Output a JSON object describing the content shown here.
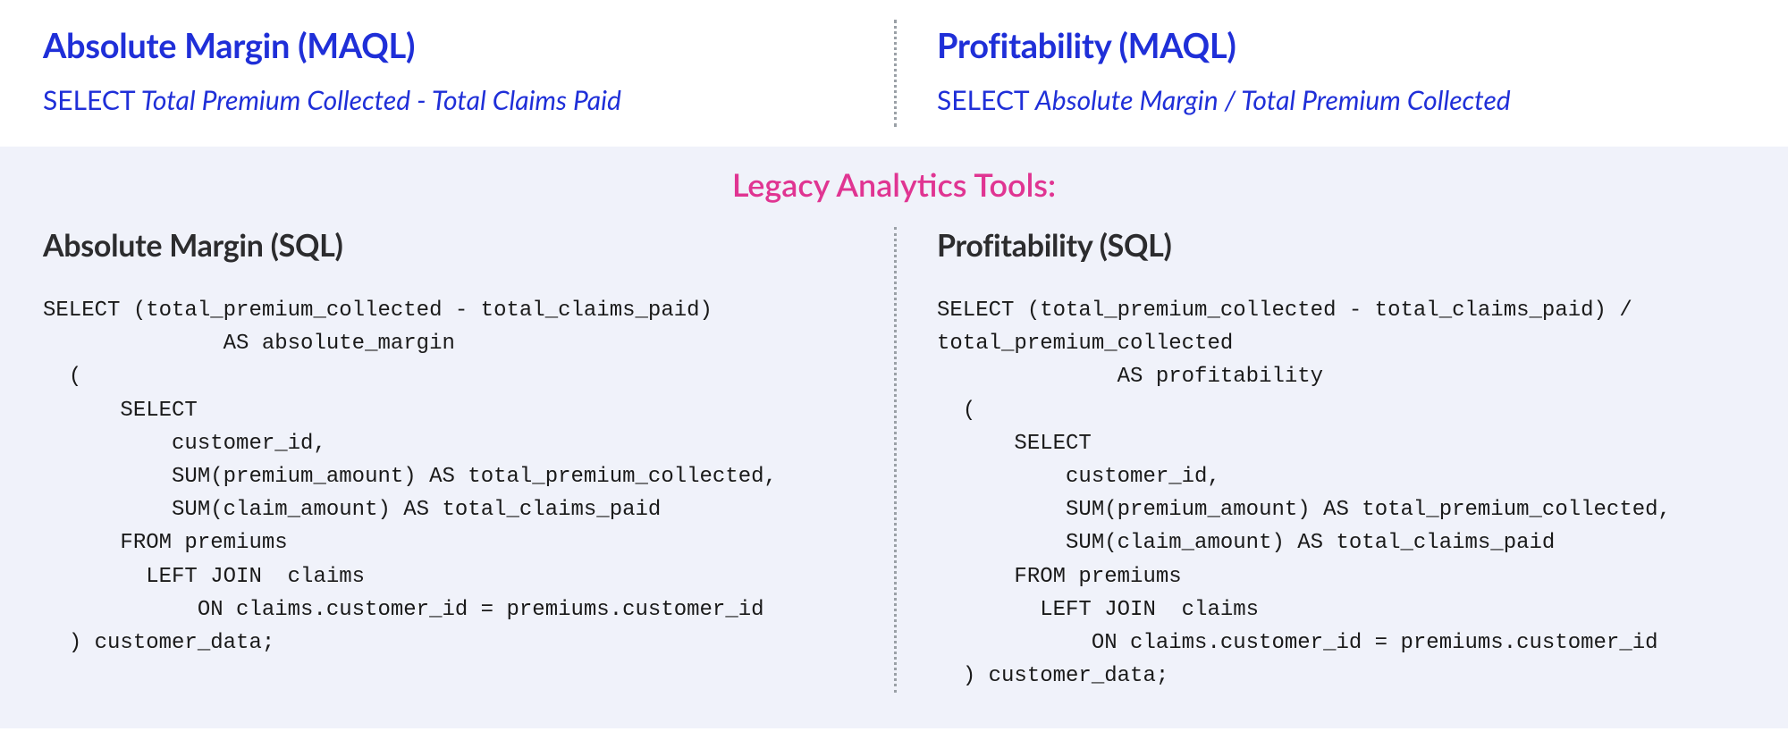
{
  "maql": {
    "left": {
      "title": "Absolute Margin (MAQL)",
      "select_keyword": "SELECT",
      "expression": "Total Premium Collected - Total Claims Paid"
    },
    "right": {
      "title": "Profitability (MAQL)",
      "select_keyword": "SELECT",
      "expression": "Absolute Margin / Total Premium Collected"
    }
  },
  "legacy": {
    "heading": "Legacy Analytics Tools:",
    "left": {
      "title": "Absolute Margin (SQL)",
      "code": "SELECT (total_premium_collected - total_claims_paid)\n              AS absolute_margin\n  (\n      SELECT\n          customer_id,\n          SUM(premium_amount) AS total_premium_collected,\n          SUM(claim_amount) AS total_claims_paid\n      FROM premiums\n        LEFT JOIN  claims\n            ON claims.customer_id = premiums.customer_id\n  ) customer_data;"
    },
    "right": {
      "title": "Profitability (SQL)",
      "code": "SELECT (total_premium_collected - total_claims_paid) / total_premium_collected\n              AS profitability\n  (\n      SELECT\n          customer_id,\n          SUM(premium_amount) AS total_premium_collected,\n          SUM(claim_amount) AS total_claims_paid\n      FROM premiums\n        LEFT JOIN  claims\n            ON claims.customer_id = premiums.customer_id\n  ) customer_data;"
    }
  }
}
